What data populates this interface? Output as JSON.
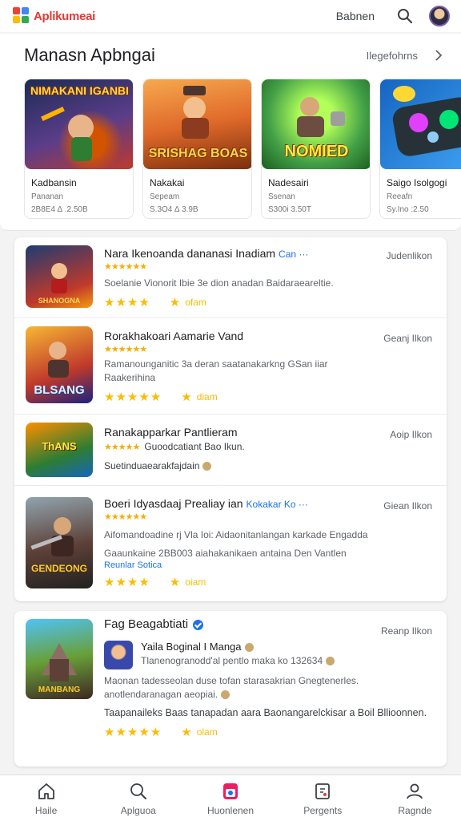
{
  "header": {
    "app_name": "Aplikumeai",
    "link": "Babnen",
    "icons": [
      "logo-icon",
      "search-icon",
      "avatar"
    ]
  },
  "featured": {
    "title": "Manasn Apbngai",
    "more_label": "Ilegefohrns",
    "items": [
      {
        "art_label": "NIMAKANI IGANBI",
        "name": "Kadbansin",
        "developer": "Pananan",
        "meta": "2B8E4 ∆ .2.50B"
      },
      {
        "art_label": "SRISHAG BOAS",
        "name": "Nakakai",
        "developer": "Sepeam",
        "meta": "S.3O4 ∆ 3.9B"
      },
      {
        "art_label": "NOMIED",
        "name": "Nadesairi",
        "developer": "Ssenan",
        "meta": "S300i 3.50T"
      },
      {
        "art_label": "",
        "name": "Saigo Isolgogi",
        "developer": "Reeafn",
        "meta": "Sy.Ino :2.50"
      }
    ]
  },
  "list": [
    {
      "title": "Nara Ikenoanda dananasi Inadiam",
      "tag": "Can ···",
      "right": "Judenlikon",
      "art_label": "SHANOGNA",
      "lines": [
        "Soelanie Vionorit  Ibie 3e dion anadan Baidaraeareltie."
      ],
      "rating_label": "ofam",
      "stars": "★★★★"
    },
    {
      "title": "Rorakhakoari Aamarie Vand",
      "tag": "",
      "right": "Geanj Ilkon",
      "art_label": "BLSANG",
      "lines": [
        "Ramanounganitic 3a deran saatanakarkng GSan iiar",
        "Raakerihina"
      ],
      "rating_label": "diam",
      "stars": "★★★★★"
    },
    {
      "title": "Ranakapparkar Pantlieram",
      "tag": "",
      "right": "Aoip Ilkon",
      "art_label": "ThANS",
      "lines": [
        "Guoodcatiant Bao Ikun.",
        "Suetinduaearakfajdain"
      ],
      "rating_label": "",
      "stars": "★★★★★"
    },
    {
      "title": "Boeri Idyasdaaj Prealiay ian",
      "tag": "Kokakar Ko ···",
      "right": "Giean Ilkon",
      "art_label": "GENDEONG",
      "lines": [
        "Aifomandoadine rj Vla Ioi: Aidaonitanlangan karkade Engadda",
        "Gaaunkaine 2BB003 aiahakanikaen antaina Den Vantlen"
      ],
      "link": "Reunlar Sotica",
      "rating_label": "oiam",
      "stars": "★★★★"
    }
  ],
  "extra": {
    "title": "Fag Beagabtiati",
    "right": "Reanp Ilkon",
    "art_label": "MANBANG",
    "sub_title": "Yaila Boginal I Manga",
    "sub_text": "Tlanenogranodd'al pentlo maka ko 132634",
    "lines": [
      "Maonan tadesseolan duse tofan starasakrian Gnegtenerles.",
      "anotlendaranagan aeopiai."
    ],
    "bold_line": "Taapanaileks Baas tanapadan aara Baonangarelckisar a Boil Bllioonnen.",
    "rating_label": "olam",
    "stars": "★★★★★"
  },
  "bottom_nav": [
    {
      "label": "Haile",
      "icon": "home-icon"
    },
    {
      "label": "Aplguoa",
      "icon": "search-icon"
    },
    {
      "label": "Huonlenen",
      "icon": "games-icon"
    },
    {
      "label": "Pergents",
      "icon": "books-icon"
    },
    {
      "label": "Ragnde",
      "icon": "profile-icon"
    }
  ]
}
